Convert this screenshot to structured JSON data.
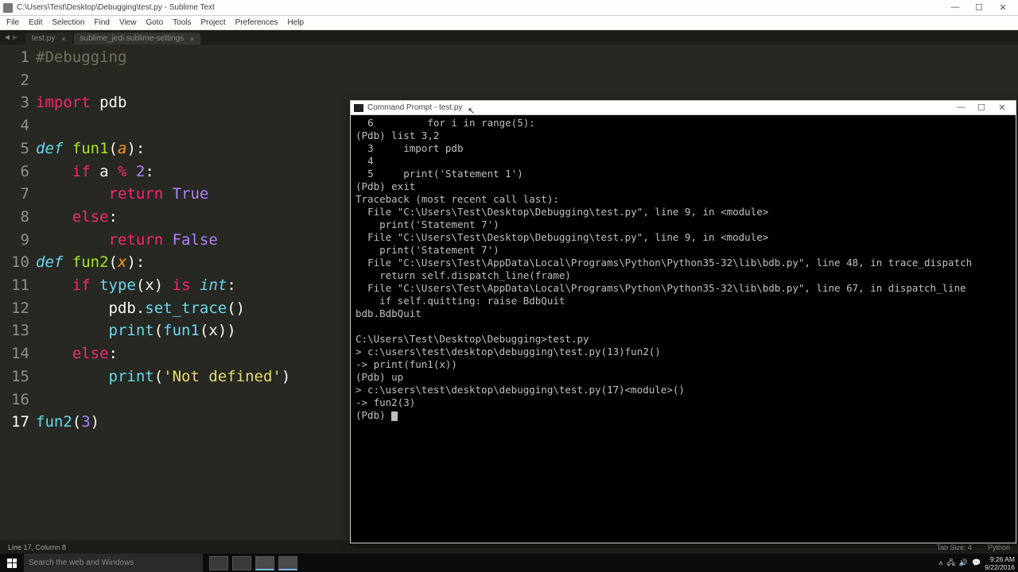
{
  "sublime": {
    "title_path": "C:\\Users\\Test\\Desktop\\Debugging\\test.py - Sublime Text",
    "menu": [
      "File",
      "Edit",
      "Selection",
      "Find",
      "View",
      "Goto",
      "Tools",
      "Project",
      "Preferences",
      "Help"
    ],
    "tabs": [
      {
        "label": "test.py",
        "active": true
      },
      {
        "label": "sublime_jedi.sublime-settings",
        "active": false
      }
    ],
    "status_left": "Line 17, Column 8",
    "status_tab": "Tab Size: 4",
    "status_lang": "Python",
    "code_lines": [
      {
        "n": 1,
        "html": "<span class='c'>#Debugging</span>"
      },
      {
        "n": 2,
        "html": ""
      },
      {
        "n": 3,
        "html": "<span class='kw2'>import</span> <span class='p'>pdb</span>"
      },
      {
        "n": 4,
        "html": ""
      },
      {
        "n": 5,
        "html": "<span class='ki'>def</span> <span class='fn'>fun1</span><span class='p'>(</span><span class='arg'>a</span><span class='p'>):</span>"
      },
      {
        "n": 6,
        "html": "    <span class='kw2'>if</span> <span class='p'>a</span> <span class='op'>%</span> <span class='num'>2</span><span class='p'>:</span>"
      },
      {
        "n": 7,
        "html": "        <span class='kw2'>return</span> <span class='num'>True</span>"
      },
      {
        "n": 8,
        "html": "    <span class='kw2'>else</span><span class='p'>:</span>"
      },
      {
        "n": 9,
        "html": "        <span class='kw2'>return</span> <span class='num'>False</span>"
      },
      {
        "n": 10,
        "html": "<span class='ki'>def</span> <span class='fn'>fun2</span><span class='p'>(</span><span class='arg'>x</span><span class='p'>):</span>"
      },
      {
        "n": 11,
        "html": "    <span class='kw2'>if</span> <span class='call'>type</span><span class='p'>(x)</span> <span class='kw2'>is</span> <span class='ki'>int</span><span class='p'>:</span>"
      },
      {
        "n": 12,
        "html": "        <span class='p'>pdb.</span><span class='call'>set_trace</span><span class='p'>()</span>"
      },
      {
        "n": 13,
        "html": "        <span class='call'>print</span><span class='p'>(</span><span class='call'>fun1</span><span class='p'>(x))</span>"
      },
      {
        "n": 14,
        "html": "    <span class='kw2'>else</span><span class='p'>:</span>"
      },
      {
        "n": 15,
        "html": "        <span class='call'>print</span><span class='p'>(</span><span class='str'>'Not defined'</span><span class='p'>)</span>"
      },
      {
        "n": 16,
        "html": ""
      },
      {
        "n": 17,
        "html": "<span class='call'>fun2</span><span class='p'>(</span><span class='num'>3</span><span class='p'>)</span>",
        "current": true
      }
    ]
  },
  "cmd": {
    "title": "Command Prompt - test.py",
    "lines": [
      "  6         for i in range(5):",
      "(Pdb) list 3,2",
      "  3     import pdb",
      "  4",
      "  5     print('Statement 1')",
      "(Pdb) exit",
      "Traceback (most recent call last):",
      "  File \"C:\\Users\\Test\\Desktop\\Debugging\\test.py\", line 9, in <module>",
      "    print('Statement 7')",
      "  File \"C:\\Users\\Test\\Desktop\\Debugging\\test.py\", line 9, in <module>",
      "    print('Statement 7')",
      "  File \"C:\\Users\\Test\\AppData\\Local\\Programs\\Python\\Python35-32\\lib\\bdb.py\", line 48, in trace_dispatch",
      "    return self.dispatch_line(frame)",
      "  File \"C:\\Users\\Test\\AppData\\Local\\Programs\\Python\\Python35-32\\lib\\bdb.py\", line 67, in dispatch_line",
      "    if self.quitting: raise BdbQuit",
      "bdb.BdbQuit",
      "",
      "C:\\Users\\Test\\Desktop\\Debugging>test.py",
      "> c:\\users\\test\\desktop\\debugging\\test.py(13)fun2()",
      "-> print(fun1(x))",
      "(Pdb) up",
      "> c:\\users\\test\\desktop\\debugging\\test.py(17)<module>()",
      "-> fun2(3)",
      "(Pdb) "
    ]
  },
  "taskbar": {
    "search_placeholder": "Search the web and Windows",
    "time": "9:26 AM",
    "date": "9/22/2016"
  }
}
